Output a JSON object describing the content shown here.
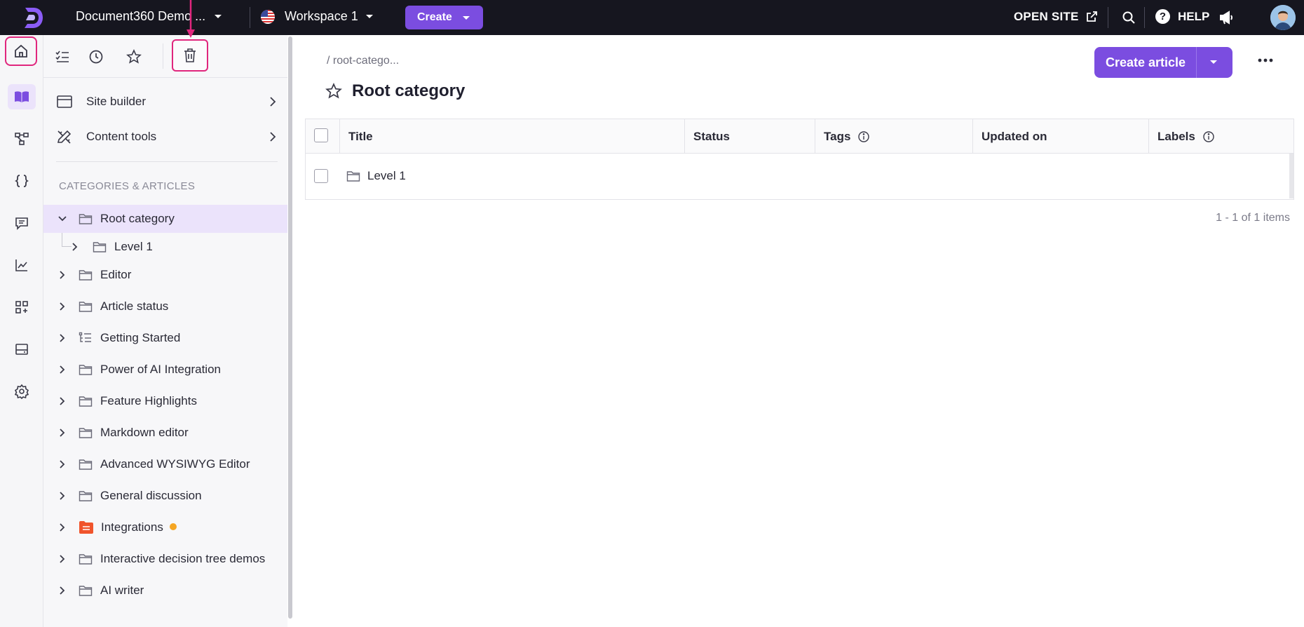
{
  "topbar": {
    "project_name": "Document360 Demo ...",
    "workspace": "Workspace 1",
    "create_label": "Create",
    "open_site_label": "OPEN SITE",
    "help_label": "HELP",
    "help_glyph": "?"
  },
  "rail": {
    "items": [
      "home-icon",
      "book-icon",
      "api-tree-icon",
      "code-braces-icon",
      "comment-icon",
      "analytics-icon",
      "apps-add-icon",
      "drive-icon",
      "settings-icon"
    ]
  },
  "panel": {
    "menu": [
      {
        "label": "Site builder",
        "icon": "browser-window-icon"
      },
      {
        "label": "Content tools",
        "icon": "pen-ruler-icon"
      }
    ],
    "section_title": "CATEGORIES & ARTICLES",
    "tree": [
      {
        "label": "Root category",
        "level": 0,
        "expanded": true,
        "selected": true,
        "icon": "folder"
      },
      {
        "label": "Level 1",
        "level": 1,
        "expanded": false,
        "icon": "folder"
      },
      {
        "label": "Editor",
        "level": 0,
        "icon": "folder"
      },
      {
        "label": "Article status",
        "level": 0,
        "icon": "folder"
      },
      {
        "label": "Getting Started",
        "level": 0,
        "icon": "list-tree"
      },
      {
        "label": "Power of AI Integration",
        "level": 0,
        "icon": "folder"
      },
      {
        "label": "Feature Highlights",
        "level": 0,
        "icon": "folder"
      },
      {
        "label": "Markdown editor",
        "level": 0,
        "icon": "folder"
      },
      {
        "label": "Advanced WYSIWYG Editor",
        "level": 0,
        "icon": "folder"
      },
      {
        "label": "General discussion",
        "level": 0,
        "icon": "folder"
      },
      {
        "label": "Integrations",
        "level": 0,
        "icon": "folder-orange",
        "status_dot": "#f5a623"
      },
      {
        "label": "Interactive decision tree demos",
        "level": 0,
        "icon": "folder"
      },
      {
        "label": "AI writer",
        "level": 0,
        "icon": "folder"
      }
    ]
  },
  "main": {
    "breadcrumb": "/ root-catego...",
    "title": "Root category",
    "create_article_label": "Create article",
    "table": {
      "columns": [
        "Title",
        "Status",
        "Tags",
        "Updated on",
        "Labels"
      ],
      "rows": [
        {
          "title": "Level 1",
          "status": "",
          "tags": "",
          "updated_on": "",
          "labels": ""
        }
      ]
    },
    "pager": "1 - 1 of 1 items"
  },
  "colors": {
    "accent": "#7b4de0",
    "topbar": "#16161f",
    "highlight": "#e0267d",
    "selected_row": "#ebe3fb"
  }
}
